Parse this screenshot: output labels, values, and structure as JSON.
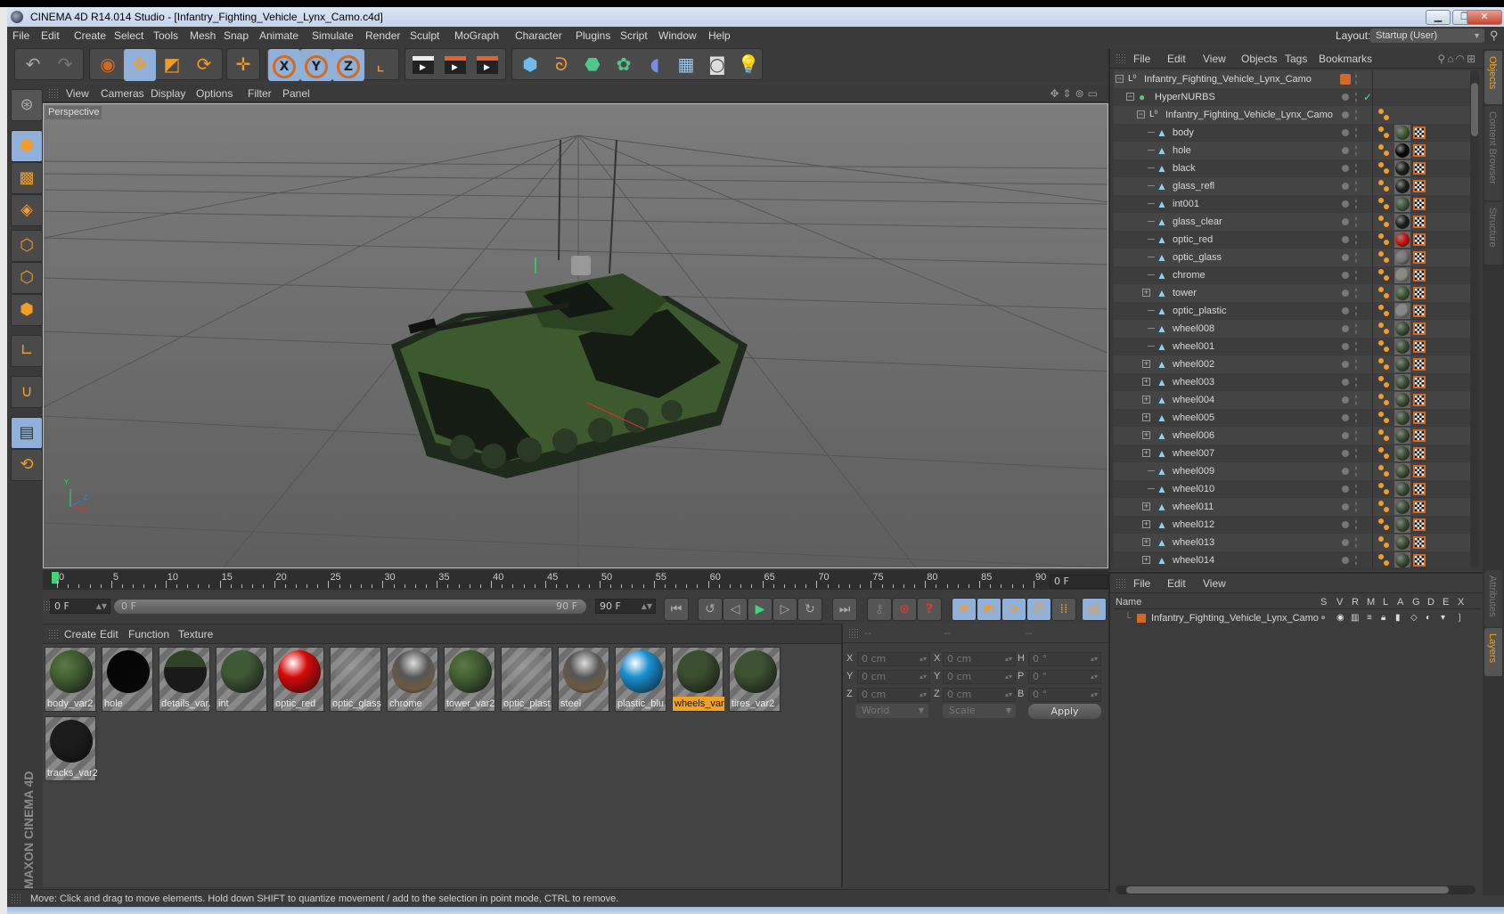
{
  "window": {
    "title": "CINEMA 4D R14.014 Studio - [Infantry_Fighting_Vehicle_Lynx_Camo.c4d]",
    "controls": [
      "minimize",
      "restore",
      "close"
    ]
  },
  "menubar": {
    "items": [
      "File",
      "Edit",
      "Create",
      "Select",
      "Tools",
      "Mesh",
      "Snap",
      "Animate",
      "Simulate",
      "Render",
      "Sculpt",
      "MoGraph",
      "Character",
      "Plugins",
      "Script",
      "Window",
      "Help"
    ],
    "layout_label": "Layout:",
    "layout_value": "Startup (User)"
  },
  "toolbar": {
    "groups": [
      {
        "tools": [
          "undo-icon",
          "redo-icon"
        ]
      },
      {
        "tools": [
          "live-selection-icon",
          "move-icon",
          "scale-icon",
          "rotate-icon"
        ]
      },
      {
        "tools": [
          "recent-tool-icon"
        ]
      },
      {
        "tools": [
          "x-axis-lock-icon",
          "y-axis-lock-icon",
          "z-axis-lock-icon",
          "coordinate-system-icon"
        ]
      },
      {
        "tools": [
          "render-view-icon",
          "render-to-picture-viewer-icon",
          "render-settings-icon"
        ]
      },
      {
        "tools": [
          "cube-icon",
          "spline-icon",
          "nurbs-icon",
          "array-icon",
          "deformer-icon",
          "floor-icon",
          "camera-icon",
          "light-icon"
        ]
      }
    ],
    "axis_labels": [
      "X",
      "Y",
      "Z"
    ]
  },
  "left_tools": [
    "model-mode-icon",
    "texture-mode-icon",
    "workplane-mode-icon",
    "points-mode-icon",
    "edges-mode-icon",
    "polygons-mode-icon",
    "axis-mode-icon",
    "magnet-icon",
    "locked-workplane-icon",
    "workplane-sync-icon"
  ],
  "viewport": {
    "menu": [
      "View",
      "Cameras",
      "Display",
      "Options",
      "Filter",
      "Panel"
    ],
    "camera_label": "Perspective",
    "axis_labels": {
      "y": "Y",
      "z": "Z",
      "x": "X"
    }
  },
  "timeline": {
    "ticks": [
      0,
      5,
      10,
      15,
      20,
      25,
      30,
      35,
      40,
      45,
      50,
      55,
      60,
      65,
      70,
      75,
      80,
      85,
      90
    ],
    "current_frame": "0 F",
    "start_field": "0 F",
    "range_start": "0 F",
    "range_end": "90 F",
    "end_field": "90 F"
  },
  "material_manager": {
    "menu": [
      "Create",
      "Edit",
      "Function",
      "Texture"
    ],
    "materials": [
      {
        "name": "body_var2",
        "color": "#3d5a2e",
        "style": "camo"
      },
      {
        "name": "hole",
        "color": "#050505",
        "style": "solid"
      },
      {
        "name": "details_var.",
        "color": "#1a1a1a",
        "style": "details"
      },
      {
        "name": "int",
        "color": "#3f5836",
        "style": "solid"
      },
      {
        "name": "optic_red",
        "color": "#d60a0a",
        "style": "glossy"
      },
      {
        "name": "optic_glass",
        "color": "#7a7a7a",
        "style": "transparent"
      },
      {
        "name": "chrome",
        "color": "#8a8a80",
        "style": "chrome"
      },
      {
        "name": "tower_var2",
        "color": "#3d5a2e",
        "style": "camo"
      },
      {
        "name": "optic_plast",
        "color": "#9a9a9a",
        "style": "transparent"
      },
      {
        "name": "steel",
        "color": "#8a8a80",
        "style": "chrome"
      },
      {
        "name": "plastic_blu",
        "color": "#1a8fcf",
        "style": "glossy"
      },
      {
        "name": "wheels_var",
        "color": "#3a4e30",
        "style": "solid",
        "selected": true
      },
      {
        "name": "tires_var2",
        "color": "#3c5232",
        "style": "solid"
      },
      {
        "name": "tracks_var2",
        "color": "#1c1c1c",
        "style": "solid"
      }
    ]
  },
  "coordinates": {
    "headers": [
      "--",
      "--",
      "--"
    ],
    "rows": [
      {
        "pos_label": "X",
        "pos": "0 cm",
        "size_label": "X",
        "size": "0 cm",
        "rot_label": "H",
        "rot": "0 °"
      },
      {
        "pos_label": "Y",
        "pos": "0 cm",
        "size_label": "Y",
        "size": "0 cm",
        "rot_label": "P",
        "rot": "0 °"
      },
      {
        "pos_label": "Z",
        "pos": "0 cm",
        "size_label": "Z",
        "size": "0 cm",
        "rot_label": "B",
        "rot": "0 °"
      }
    ],
    "space": "World",
    "mode": "Scale",
    "apply_label": "Apply"
  },
  "object_manager": {
    "menu": [
      "File",
      "Edit",
      "View",
      "Objects",
      "Tags",
      "Bookmarks"
    ],
    "objects": [
      {
        "name": "Infantry_Fighting_Vehicle_Lynx_Camo",
        "type": "null",
        "depth": 0,
        "expander": "minus",
        "layer": true
      },
      {
        "name": "HyperNURBS",
        "type": "nurbs",
        "depth": 1,
        "expander": "minus",
        "check": true
      },
      {
        "name": "Infantry_Fighting_Vehicle_Lynx_Camo",
        "type": "null",
        "depth": 2,
        "expander": "minus",
        "phong": true
      },
      {
        "name": "body",
        "type": "poly",
        "depth": 3,
        "mat": "#3d5a2e"
      },
      {
        "name": "hole",
        "type": "poly",
        "depth": 3,
        "mat": "#050505"
      },
      {
        "name": "black",
        "type": "poly",
        "depth": 3,
        "mat": "#1a1f1a"
      },
      {
        "name": "glass_refl",
        "type": "poly",
        "depth": 3,
        "mat": "#1a1f1a"
      },
      {
        "name": "int001",
        "type": "poly",
        "depth": 3,
        "mat": "#3f5836"
      },
      {
        "name": "glass_clear",
        "type": "poly",
        "depth": 3,
        "mat": "#1a1f1a"
      },
      {
        "name": "optic_red",
        "type": "poly",
        "depth": 3,
        "mat": "#d60a0a"
      },
      {
        "name": "optic_glass",
        "type": "poly",
        "depth": 3,
        "mat": "#777777"
      },
      {
        "name": "chrome",
        "type": "poly",
        "depth": 3,
        "mat": "#8a8a80"
      },
      {
        "name": "tower",
        "type": "poly",
        "depth": 3,
        "expander": "plus",
        "mat": "#3d5a2e"
      },
      {
        "name": "optic_plastic",
        "type": "poly",
        "depth": 3,
        "mat": "#888888"
      },
      {
        "name": "wheel008",
        "type": "poly",
        "depth": 3,
        "mat": "#3a4e30"
      },
      {
        "name": "wheel001",
        "type": "poly",
        "depth": 3,
        "mat": "#3a4e30"
      },
      {
        "name": "wheel002",
        "type": "poly",
        "depth": 3,
        "expander": "plus",
        "mat": "#3a4e30"
      },
      {
        "name": "wheel003",
        "type": "poly",
        "depth": 3,
        "expander": "plus",
        "mat": "#3a4e30"
      },
      {
        "name": "wheel004",
        "type": "poly",
        "depth": 3,
        "expander": "plus",
        "mat": "#3a4e30"
      },
      {
        "name": "wheel005",
        "type": "poly",
        "depth": 3,
        "expander": "plus",
        "mat": "#3a4e30"
      },
      {
        "name": "wheel006",
        "type": "poly",
        "depth": 3,
        "expander": "plus",
        "mat": "#3a4e30"
      },
      {
        "name": "wheel007",
        "type": "poly",
        "depth": 3,
        "expander": "plus",
        "mat": "#3a4e30"
      },
      {
        "name": "wheel009",
        "type": "poly",
        "depth": 3,
        "mat": "#3a4e30"
      },
      {
        "name": "wheel010",
        "type": "poly",
        "depth": 3,
        "mat": "#3a4e30"
      },
      {
        "name": "wheel011",
        "type": "poly",
        "depth": 3,
        "expander": "plus",
        "mat": "#3a4e30"
      },
      {
        "name": "wheel012",
        "type": "poly",
        "depth": 3,
        "expander": "plus",
        "mat": "#3a4e30"
      },
      {
        "name": "wheel013",
        "type": "poly",
        "depth": 3,
        "expander": "plus",
        "mat": "#3a4e30"
      },
      {
        "name": "wheel014",
        "type": "poly",
        "depth": 3,
        "expander": "plus",
        "mat": "#3a4e30"
      }
    ]
  },
  "side_tabs": {
    "top": [
      {
        "label": "Objects",
        "active": true
      },
      {
        "label": "Content Browser"
      },
      {
        "label": "Structure"
      }
    ],
    "bottom": [
      {
        "label": "Attributes"
      },
      {
        "label": "Layers",
        "active": true
      }
    ]
  },
  "layer_manager": {
    "menu": [
      "File",
      "Edit",
      "View"
    ],
    "columns": [
      "Name",
      "S",
      "V",
      "R",
      "M",
      "L",
      "A",
      "G",
      "D",
      "E",
      "X"
    ],
    "layers": [
      {
        "name": "Infantry_Fighting_Vehicle_Lynx_Camo",
        "color": "#d4682a"
      }
    ]
  },
  "status_bar": {
    "text": "Move: Click and drag to move elements. Hold down SHIFT to quantize movement / add to the selection in point mode, CTRL to remove."
  },
  "branding": {
    "logo": "MAXON CINEMA 4D"
  },
  "colors": {
    "accent": "#f29c2a",
    "selection": "#8fb0d8",
    "playhead": "#3fd57a",
    "layer": "#d4682a"
  }
}
